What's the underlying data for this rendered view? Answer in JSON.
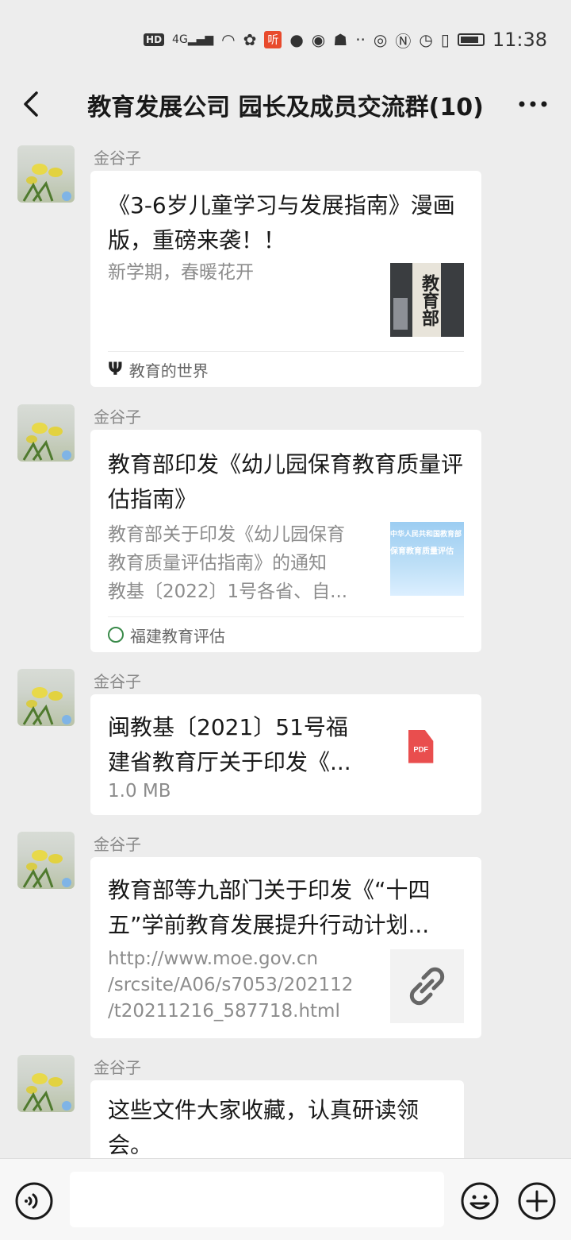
{
  "status_bar": {
    "hd": "HD",
    "network": "4G",
    "ting": "听",
    "time": "11:38"
  },
  "header": {
    "title": "教育发展公司 园长及成员交流群(10)",
    "back_icon": "chevron-left-icon",
    "more_icon": "more-dots-icon"
  },
  "messages": [
    {
      "sender": "金谷子",
      "type": "article",
      "title": "《3-6岁儿童学习与发展指南》漫画版，重磅来袭！！",
      "desc": "新学期，春暖花开",
      "thumb_text": "教育部",
      "source": "教育的世界"
    },
    {
      "sender": "金谷子",
      "type": "article",
      "title": "教育部印发《幼儿园保育教育质量评估指南》",
      "desc_lines": [
        "教育部关于印发《幼儿园保育",
        "教育质量评估指南》的通知",
        "教基〔2022〕1号各省、自..."
      ],
      "thumb_text_1": "中华人民共和国教育部",
      "thumb_text_2": "保育教育质量评估",
      "source": "福建教育评估"
    },
    {
      "sender": "金谷子",
      "type": "file",
      "title_lines": [
        "闽教基〔2021〕51号福",
        "建省教育厅关于印发《..."
      ],
      "size": "1.0 MB",
      "file_badge": "PDF"
    },
    {
      "sender": "金谷子",
      "type": "link",
      "title_lines": [
        "教育部等九部门关于印发《“十四",
        "五”学前教育发展提升行动计划..."
      ],
      "url_lines": [
        "http://www.moe.gov.cn",
        "/srcsite/A06/s7053/202112",
        "/t20211216_587718.html"
      ],
      "link_icon": "link-icon"
    },
    {
      "sender": "金谷子",
      "type": "text",
      "text_lines": [
        "这些文件大家收藏，认真研读领",
        "会。"
      ]
    }
  ],
  "input_bar": {
    "voice_icon": "voice-icon",
    "emoji_icon": "emoji-icon",
    "plus_icon": "plus-icon",
    "placeholder": ""
  },
  "colors": {
    "background": "#ededed",
    "bubble": "#ffffff",
    "pdf_red": "#e94e4e",
    "secondary_text": "#8c8c8c"
  }
}
